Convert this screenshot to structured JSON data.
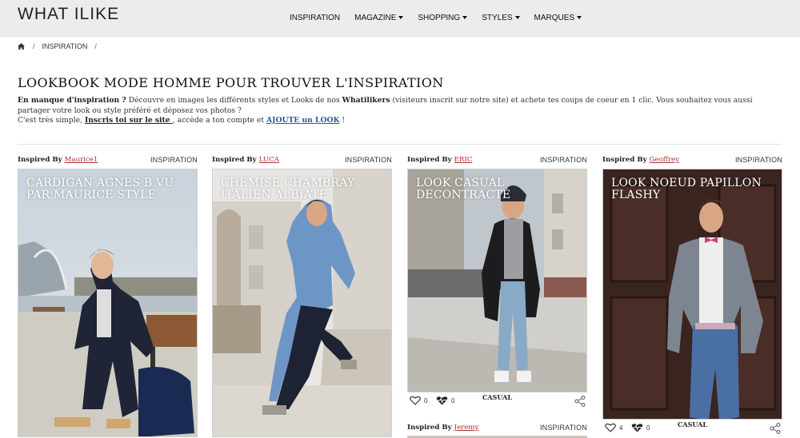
{
  "header": {
    "logo": "WHAT ILIKE",
    "nav": [
      {
        "label": "INSPIRATION",
        "dropdown": false
      },
      {
        "label": "MAGAZINE",
        "dropdown": true
      },
      {
        "label": "SHOPPING",
        "dropdown": true
      },
      {
        "label": "STYLES",
        "dropdown": true
      },
      {
        "label": "MARQUES",
        "dropdown": true
      }
    ]
  },
  "breadcrumb": {
    "home_icon": "home-icon",
    "sep": "/",
    "current": "INSPIRATION",
    "sep2": "/"
  },
  "page": {
    "title": "LOOKBOOK MODE HOMME POUR TROUVER L'INSPIRATION",
    "intro": {
      "lead_bold": "En manque d'inspiration ?",
      "text1": " Découvre en images les différents styles et Looks de nos ",
      "whatilikers": "Whatilikers",
      "text2": " (visiteurs inscrit sur notre site) et achete tes coups de coeur en 1 clic. Vous souhaitez vous aussi partager votre look ou style préféré et déposez vos photos ?",
      "text3": "C'est très simple, ",
      "link_signup": "Inscris toi sur le site ",
      "text4": ", accède a ton compte et ",
      "link_add": "AJOUTE un LOOK",
      "text5": " !"
    }
  },
  "cards": [
    {
      "inspired_by": "Inspired By",
      "user": "Maurice1",
      "category": "INSPIRATION",
      "title": "CARDIGAN AGNES B VU PAR MAURICE STYLE"
    },
    {
      "inspired_by": "Inspired By",
      "user": "LUCA",
      "category": "INSPIRATION",
      "title": "CHEMISE CHAMBRAY ITALIEN ALBIATE"
    },
    {
      "inspired_by": "Inspired By",
      "user": "ERIC",
      "category": "INSPIRATION",
      "title": "LOOK CASUAL DECONTRACTÉ",
      "likes": "0",
      "hearts": "0",
      "style": "CASUAL"
    },
    {
      "inspired_by": "Inspired By",
      "user": "Geoffrey",
      "category": "INSPIRATION",
      "title": "LOOK NOEUD PAPILLON FLASHY",
      "likes": "4",
      "hearts": "0",
      "style": "CASUAL"
    },
    {
      "inspired_by": "Inspired By",
      "user": "Jeremy",
      "category": "INSPIRATION"
    }
  ],
  "icons": {
    "like": "heart-outline-icon",
    "heartbeat": "heartbeat-icon",
    "share": "share-icon"
  }
}
